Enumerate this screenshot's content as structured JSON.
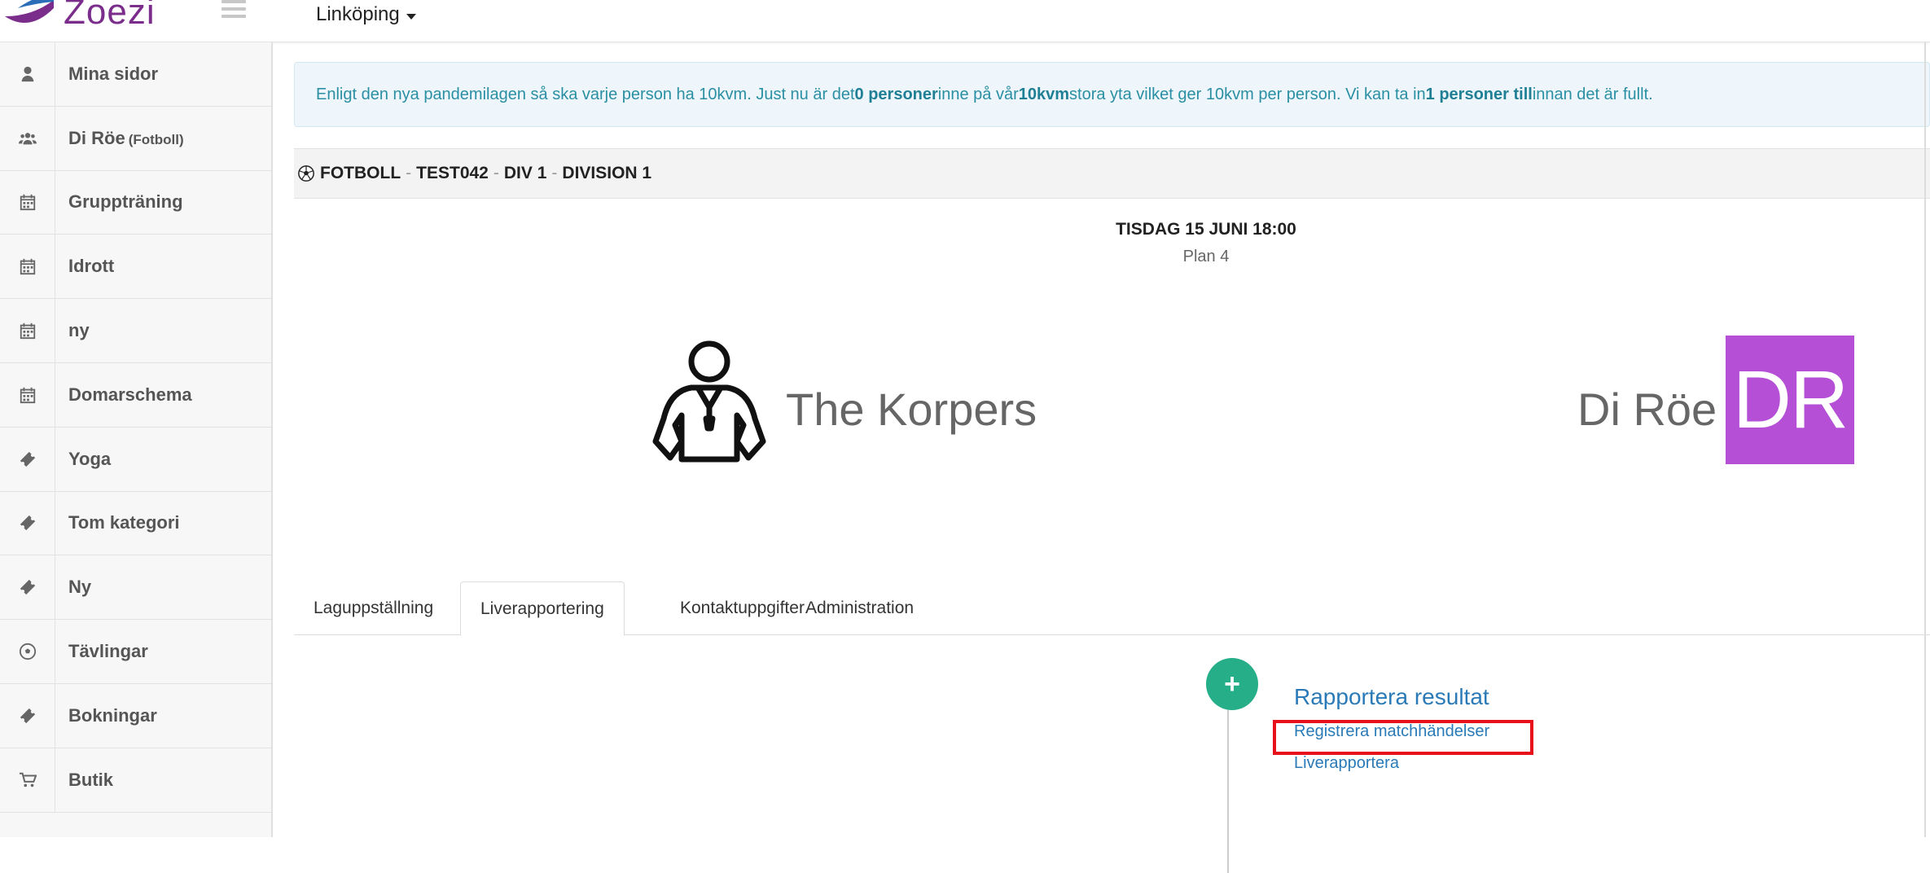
{
  "brand": {
    "name": "Zoezi"
  },
  "header": {
    "city": "Linköping"
  },
  "sidebar": {
    "items": [
      {
        "label": "Mina sidor",
        "sub": "",
        "icon": "user-icon"
      },
      {
        "label": "Di Röe",
        "sub": "(Fotboll)",
        "icon": "group-icon"
      },
      {
        "label": "Gruppträning",
        "sub": "",
        "icon": "calendar-icon"
      },
      {
        "label": "Idrott",
        "sub": "",
        "icon": "calendar-icon"
      },
      {
        "label": "ny",
        "sub": "",
        "icon": "calendar-icon"
      },
      {
        "label": "Domarschema",
        "sub": "",
        "icon": "calendar-icon"
      },
      {
        "label": "Yoga",
        "sub": "",
        "icon": "ticket-icon"
      },
      {
        "label": "Tom kategori",
        "sub": "",
        "icon": "ticket-icon"
      },
      {
        "label": "Ny",
        "sub": "",
        "icon": "ticket-icon"
      },
      {
        "label": "Tävlingar",
        "sub": "",
        "icon": "soccer-ball-icon"
      },
      {
        "label": "Bokningar",
        "sub": "",
        "icon": "ticket-icon"
      },
      {
        "label": "Butik",
        "sub": "",
        "icon": "cart-icon"
      }
    ]
  },
  "notice": {
    "p1": "Enligt den nya pandemilagen så ska varje person ha 10kvm. Just nu är det ",
    "b1": "0 personer",
    "p2": " inne på vår ",
    "b2": "10kvm",
    "p3": " stora yta vilket ger 10kvm per person. Vi kan ta in ",
    "b3": "1 personer till",
    "p4": " innan det är fullt."
  },
  "match": {
    "sport": "FOTBOLL",
    "code": "TEST042",
    "div": "DIV 1",
    "division": "DIVISION 1",
    "sep": "-",
    "date": "TISDAG 15 JUNI 18:00",
    "field": "Plan 4",
    "home": "The Korpers",
    "away": "Di Röe",
    "away_initials": "DR",
    "away_color": "#b44fd6"
  },
  "tabs": [
    {
      "label": "Laguppställning"
    },
    {
      "label": "Liverapportering",
      "active": true
    },
    {
      "label": "Kontaktuppgifter"
    },
    {
      "label": "Administration"
    }
  ],
  "timeline": {
    "report_title": "Rapportera resultat",
    "register_link": "Registrera matchhändelser",
    "live_link": "Liverapportera",
    "plus": "+"
  }
}
